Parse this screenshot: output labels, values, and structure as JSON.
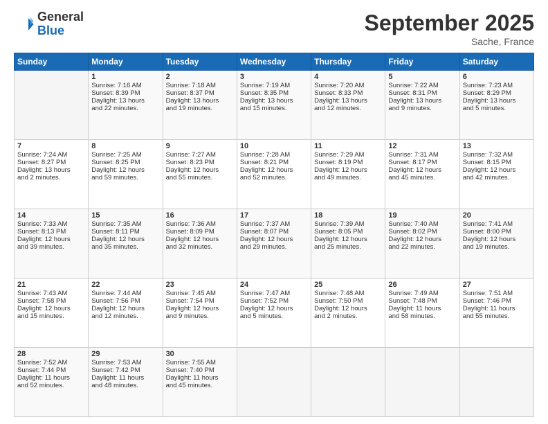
{
  "header": {
    "logo_general": "General",
    "logo_blue": "Blue",
    "title": "September 2025",
    "location": "Sache, France"
  },
  "days_of_week": [
    "Sunday",
    "Monday",
    "Tuesday",
    "Wednesday",
    "Thursday",
    "Friday",
    "Saturday"
  ],
  "weeks": [
    [
      {
        "day": "",
        "info": ""
      },
      {
        "day": "1",
        "info": "Sunrise: 7:16 AM\nSunset: 8:39 PM\nDaylight: 13 hours\nand 22 minutes."
      },
      {
        "day": "2",
        "info": "Sunrise: 7:18 AM\nSunset: 8:37 PM\nDaylight: 13 hours\nand 19 minutes."
      },
      {
        "day": "3",
        "info": "Sunrise: 7:19 AM\nSunset: 8:35 PM\nDaylight: 13 hours\nand 15 minutes."
      },
      {
        "day": "4",
        "info": "Sunrise: 7:20 AM\nSunset: 8:33 PM\nDaylight: 13 hours\nand 12 minutes."
      },
      {
        "day": "5",
        "info": "Sunrise: 7:22 AM\nSunset: 8:31 PM\nDaylight: 13 hours\nand 9 minutes."
      },
      {
        "day": "6",
        "info": "Sunrise: 7:23 AM\nSunset: 8:29 PM\nDaylight: 13 hours\nand 5 minutes."
      }
    ],
    [
      {
        "day": "7",
        "info": "Sunrise: 7:24 AM\nSunset: 8:27 PM\nDaylight: 13 hours\nand 2 minutes."
      },
      {
        "day": "8",
        "info": "Sunrise: 7:25 AM\nSunset: 8:25 PM\nDaylight: 12 hours\nand 59 minutes."
      },
      {
        "day": "9",
        "info": "Sunrise: 7:27 AM\nSunset: 8:23 PM\nDaylight: 12 hours\nand 55 minutes."
      },
      {
        "day": "10",
        "info": "Sunrise: 7:28 AM\nSunset: 8:21 PM\nDaylight: 12 hours\nand 52 minutes."
      },
      {
        "day": "11",
        "info": "Sunrise: 7:29 AM\nSunset: 8:19 PM\nDaylight: 12 hours\nand 49 minutes."
      },
      {
        "day": "12",
        "info": "Sunrise: 7:31 AM\nSunset: 8:17 PM\nDaylight: 12 hours\nand 45 minutes."
      },
      {
        "day": "13",
        "info": "Sunrise: 7:32 AM\nSunset: 8:15 PM\nDaylight: 12 hours\nand 42 minutes."
      }
    ],
    [
      {
        "day": "14",
        "info": "Sunrise: 7:33 AM\nSunset: 8:13 PM\nDaylight: 12 hours\nand 39 minutes."
      },
      {
        "day": "15",
        "info": "Sunrise: 7:35 AM\nSunset: 8:11 PM\nDaylight: 12 hours\nand 35 minutes."
      },
      {
        "day": "16",
        "info": "Sunrise: 7:36 AM\nSunset: 8:09 PM\nDaylight: 12 hours\nand 32 minutes."
      },
      {
        "day": "17",
        "info": "Sunrise: 7:37 AM\nSunset: 8:07 PM\nDaylight: 12 hours\nand 29 minutes."
      },
      {
        "day": "18",
        "info": "Sunrise: 7:39 AM\nSunset: 8:05 PM\nDaylight: 12 hours\nand 25 minutes."
      },
      {
        "day": "19",
        "info": "Sunrise: 7:40 AM\nSunset: 8:02 PM\nDaylight: 12 hours\nand 22 minutes."
      },
      {
        "day": "20",
        "info": "Sunrise: 7:41 AM\nSunset: 8:00 PM\nDaylight: 12 hours\nand 19 minutes."
      }
    ],
    [
      {
        "day": "21",
        "info": "Sunrise: 7:43 AM\nSunset: 7:58 PM\nDaylight: 12 hours\nand 15 minutes."
      },
      {
        "day": "22",
        "info": "Sunrise: 7:44 AM\nSunset: 7:56 PM\nDaylight: 12 hours\nand 12 minutes."
      },
      {
        "day": "23",
        "info": "Sunrise: 7:45 AM\nSunset: 7:54 PM\nDaylight: 12 hours\nand 9 minutes."
      },
      {
        "day": "24",
        "info": "Sunrise: 7:47 AM\nSunset: 7:52 PM\nDaylight: 12 hours\nand 5 minutes."
      },
      {
        "day": "25",
        "info": "Sunrise: 7:48 AM\nSunset: 7:50 PM\nDaylight: 12 hours\nand 2 minutes."
      },
      {
        "day": "26",
        "info": "Sunrise: 7:49 AM\nSunset: 7:48 PM\nDaylight: 11 hours\nand 58 minutes."
      },
      {
        "day": "27",
        "info": "Sunrise: 7:51 AM\nSunset: 7:46 PM\nDaylight: 11 hours\nand 55 minutes."
      }
    ],
    [
      {
        "day": "28",
        "info": "Sunrise: 7:52 AM\nSunset: 7:44 PM\nDaylight: 11 hours\nand 52 minutes."
      },
      {
        "day": "29",
        "info": "Sunrise: 7:53 AM\nSunset: 7:42 PM\nDaylight: 11 hours\nand 48 minutes."
      },
      {
        "day": "30",
        "info": "Sunrise: 7:55 AM\nSunset: 7:40 PM\nDaylight: 11 hours\nand 45 minutes."
      },
      {
        "day": "",
        "info": ""
      },
      {
        "day": "",
        "info": ""
      },
      {
        "day": "",
        "info": ""
      },
      {
        "day": "",
        "info": ""
      }
    ]
  ]
}
